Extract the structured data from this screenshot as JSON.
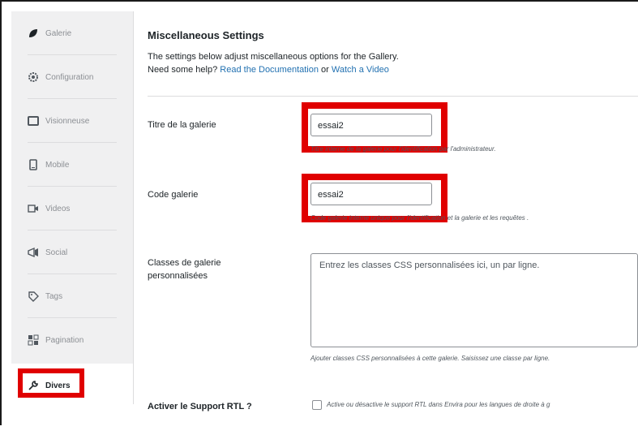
{
  "sidebar": {
    "items": [
      {
        "label": "Galerie",
        "icon": "leaf-icon"
      },
      {
        "label": "Configuration",
        "icon": "gear-icon"
      },
      {
        "label": "Visionneuse",
        "icon": "lightbox-icon"
      },
      {
        "label": "Mobile",
        "icon": "mobile-icon"
      },
      {
        "label": "Videos",
        "icon": "video-icon"
      },
      {
        "label": "Social",
        "icon": "megaphone-icon"
      },
      {
        "label": "Tags",
        "icon": "tag-icon"
      },
      {
        "label": "Pagination",
        "icon": "pagination-icon"
      },
      {
        "label": "Divers",
        "icon": "wrench-icon"
      }
    ],
    "active": "Divers"
  },
  "main": {
    "title": "Miscellaneous Settings",
    "description": "The settings below adjust miscellaneous options for the Gallery.",
    "help_prefix": "Need some help?",
    "docs_link": "Read the Documentation",
    "or_text": "or",
    "video_link": "Watch a Video",
    "fields": {
      "gallery_title": {
        "label": "Titre de la galerie",
        "value": "essai2",
        "help": "Titre interne de la galerie pour l'identification par l'administrateur."
      },
      "gallery_code": {
        "label": "Code galerie",
        "value": "essai2",
        "help": "Code galerie interne unique pour l'identification et la galerie et les requêtes ."
      },
      "custom_classes": {
        "label": "Classes de galerie personnalisées",
        "placeholder": "Entrez les classes CSS personnalisées ici, un par ligne.",
        "help": "Ajouter classes CSS personnalisées à cette galerie. Saisissez une classe par ligne."
      },
      "rtl": {
        "label": "Activer le Support RTL ?",
        "help": "Active ou désactive le support RTL dans Envira pour les langues de droite à g"
      }
    }
  },
  "colors": {
    "highlight": "#e00000",
    "link": "#2271b1",
    "sidebar_bg": "#f0f0f1"
  }
}
